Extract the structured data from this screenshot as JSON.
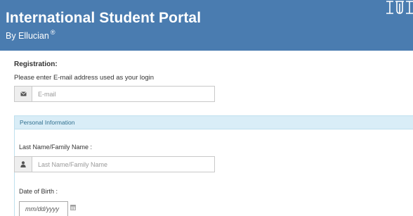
{
  "header": {
    "title": "International Student Portal",
    "subtitle": "By Ellucian",
    "registered_mark": "®",
    "logo_icon": "iu-trident-logo-icon"
  },
  "colors": {
    "header_bg": "#4a7cb0",
    "panel_heading_bg": "#d9edf7",
    "panel_heading_text": "#31708f"
  },
  "registration": {
    "label": "Registration:",
    "hint": "Please enter E-mail address used as your login",
    "email": {
      "icon": "envelope-icon",
      "placeholder": "E-mail",
      "value": ""
    }
  },
  "personal_info": {
    "heading": "Personal Information",
    "last_name": {
      "label": "Last Name/Family Name :",
      "icon": "user-icon",
      "placeholder": "Last Name/Family Name",
      "value": ""
    },
    "dob": {
      "label": "Date of Birth :",
      "placeholder": "mm/dd/yyyy",
      "value": "",
      "icon": "calendar-icon"
    }
  }
}
